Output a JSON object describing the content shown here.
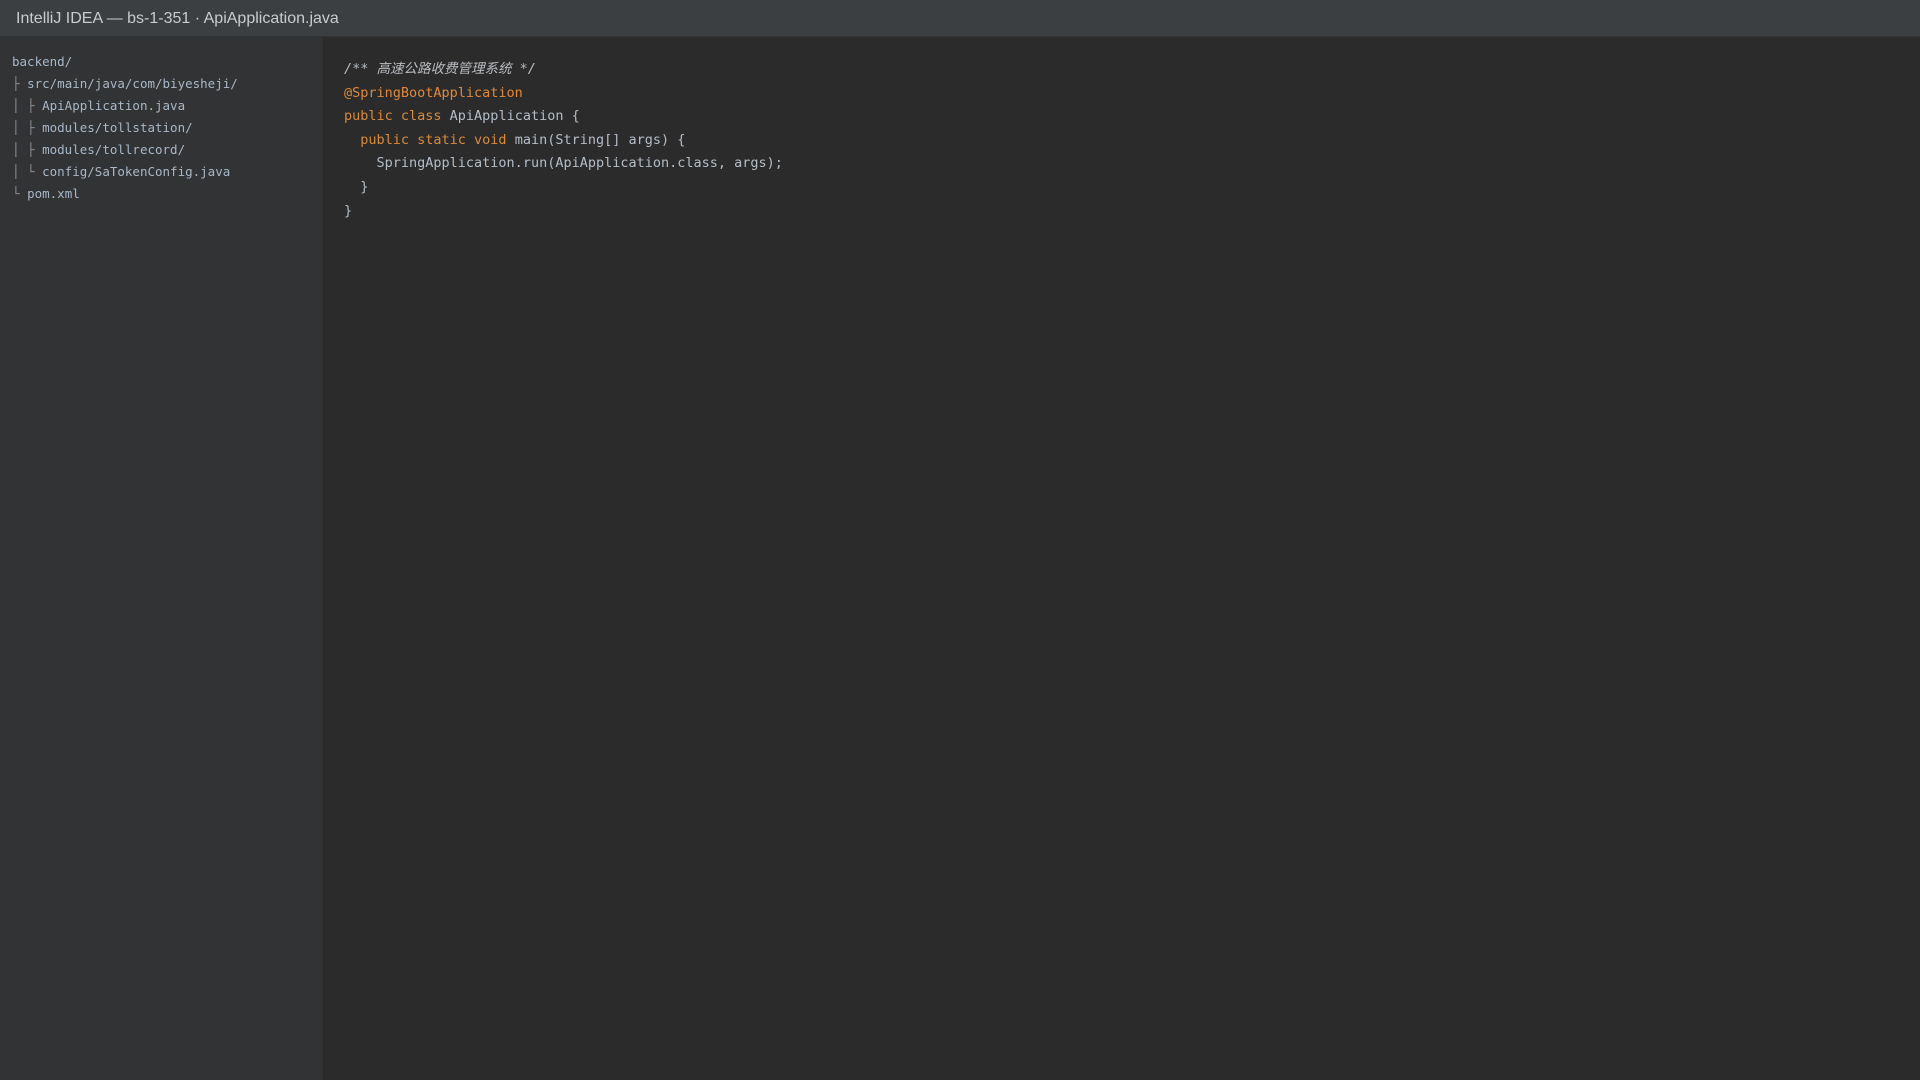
{
  "window": {
    "title": "IntelliJ IDEA — bs-1-351 · ApiApplication.java"
  },
  "project_tree": {
    "items": [
      {
        "prefix": "",
        "label": "backend/"
      },
      {
        "prefix": "├ ",
        "label": "src/main/java/com/biyesheji/"
      },
      {
        "prefix": "│ ├ ",
        "label": "ApiApplication.java"
      },
      {
        "prefix": "│ ├ ",
        "label": "modules/tollstation/"
      },
      {
        "prefix": "│ ├ ",
        "label": "modules/tollrecord/"
      },
      {
        "prefix": "│ └ ",
        "label": "config/SaTokenConfig.java"
      },
      {
        "prefix": "└ ",
        "label": "pom.xml"
      }
    ]
  },
  "editor": {
    "lines": [
      {
        "indent": "",
        "parts": [
          {
            "kind": "comment",
            "text": "/** 高速公路收费管理系统 */"
          }
        ]
      },
      {
        "indent": "",
        "parts": [
          {
            "kind": "annot",
            "text": "@SpringBootApplication"
          }
        ]
      },
      {
        "indent": "",
        "parts": [
          {
            "kind": "kw",
            "text": "public class "
          },
          {
            "kind": "plain",
            "text": "ApiApplication {"
          }
        ]
      },
      {
        "indent": "  ",
        "parts": [
          {
            "kind": "kw",
            "text": "public static void "
          },
          {
            "kind": "plain",
            "text": "main(String[] args) {"
          }
        ]
      },
      {
        "indent": "    ",
        "parts": [
          {
            "kind": "plain",
            "text": "SpringApplication.run(ApiApplication.class, args);"
          }
        ]
      },
      {
        "indent": "  ",
        "parts": [
          {
            "kind": "plain",
            "text": "}"
          }
        ]
      },
      {
        "indent": "",
        "parts": [
          {
            "kind": "plain",
            "text": "}"
          }
        ]
      }
    ]
  },
  "colors": {
    "titlebar_bg": "#3c3f41",
    "sidebar_bg": "#313335",
    "editor_bg": "#2b2b2b",
    "keyword": "#d98a3c",
    "annotation": "#e0883a",
    "text": "#a9b7c6"
  }
}
